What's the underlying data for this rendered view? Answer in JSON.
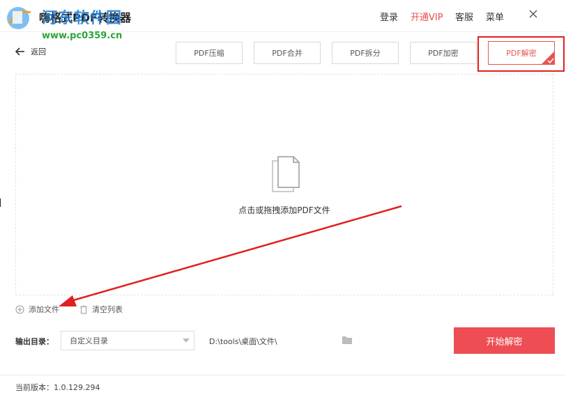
{
  "window": {
    "title": "嗨格式PDF转换器",
    "watermark_title": "河东软件园",
    "watermark_url": "www.pc0359.cn"
  },
  "topnav": {
    "login": "登录",
    "vip": "开通VIP",
    "service": "客服",
    "menu": "菜单"
  },
  "back_label": "返回",
  "tabs": [
    {
      "label": "PDF压缩"
    },
    {
      "label": "PDF合并"
    },
    {
      "label": "PDF拆分"
    },
    {
      "label": "PDF加密"
    },
    {
      "label": "PDF解密"
    }
  ],
  "active_tab": "PDF解密",
  "dropzone": {
    "hint": "点击或拖拽添加PDF文件"
  },
  "actions": {
    "add_file": "添加文件",
    "clear_list": "清空列表"
  },
  "output": {
    "label": "输出目录：",
    "selected": "自定义目录",
    "path": "D:\\tools\\桌面\\文件\\"
  },
  "start_button": "开始解密",
  "version": "当前版本：1.0.129.294",
  "colors": {
    "accent": "#ee4d54",
    "annotation": "#e02020"
  }
}
